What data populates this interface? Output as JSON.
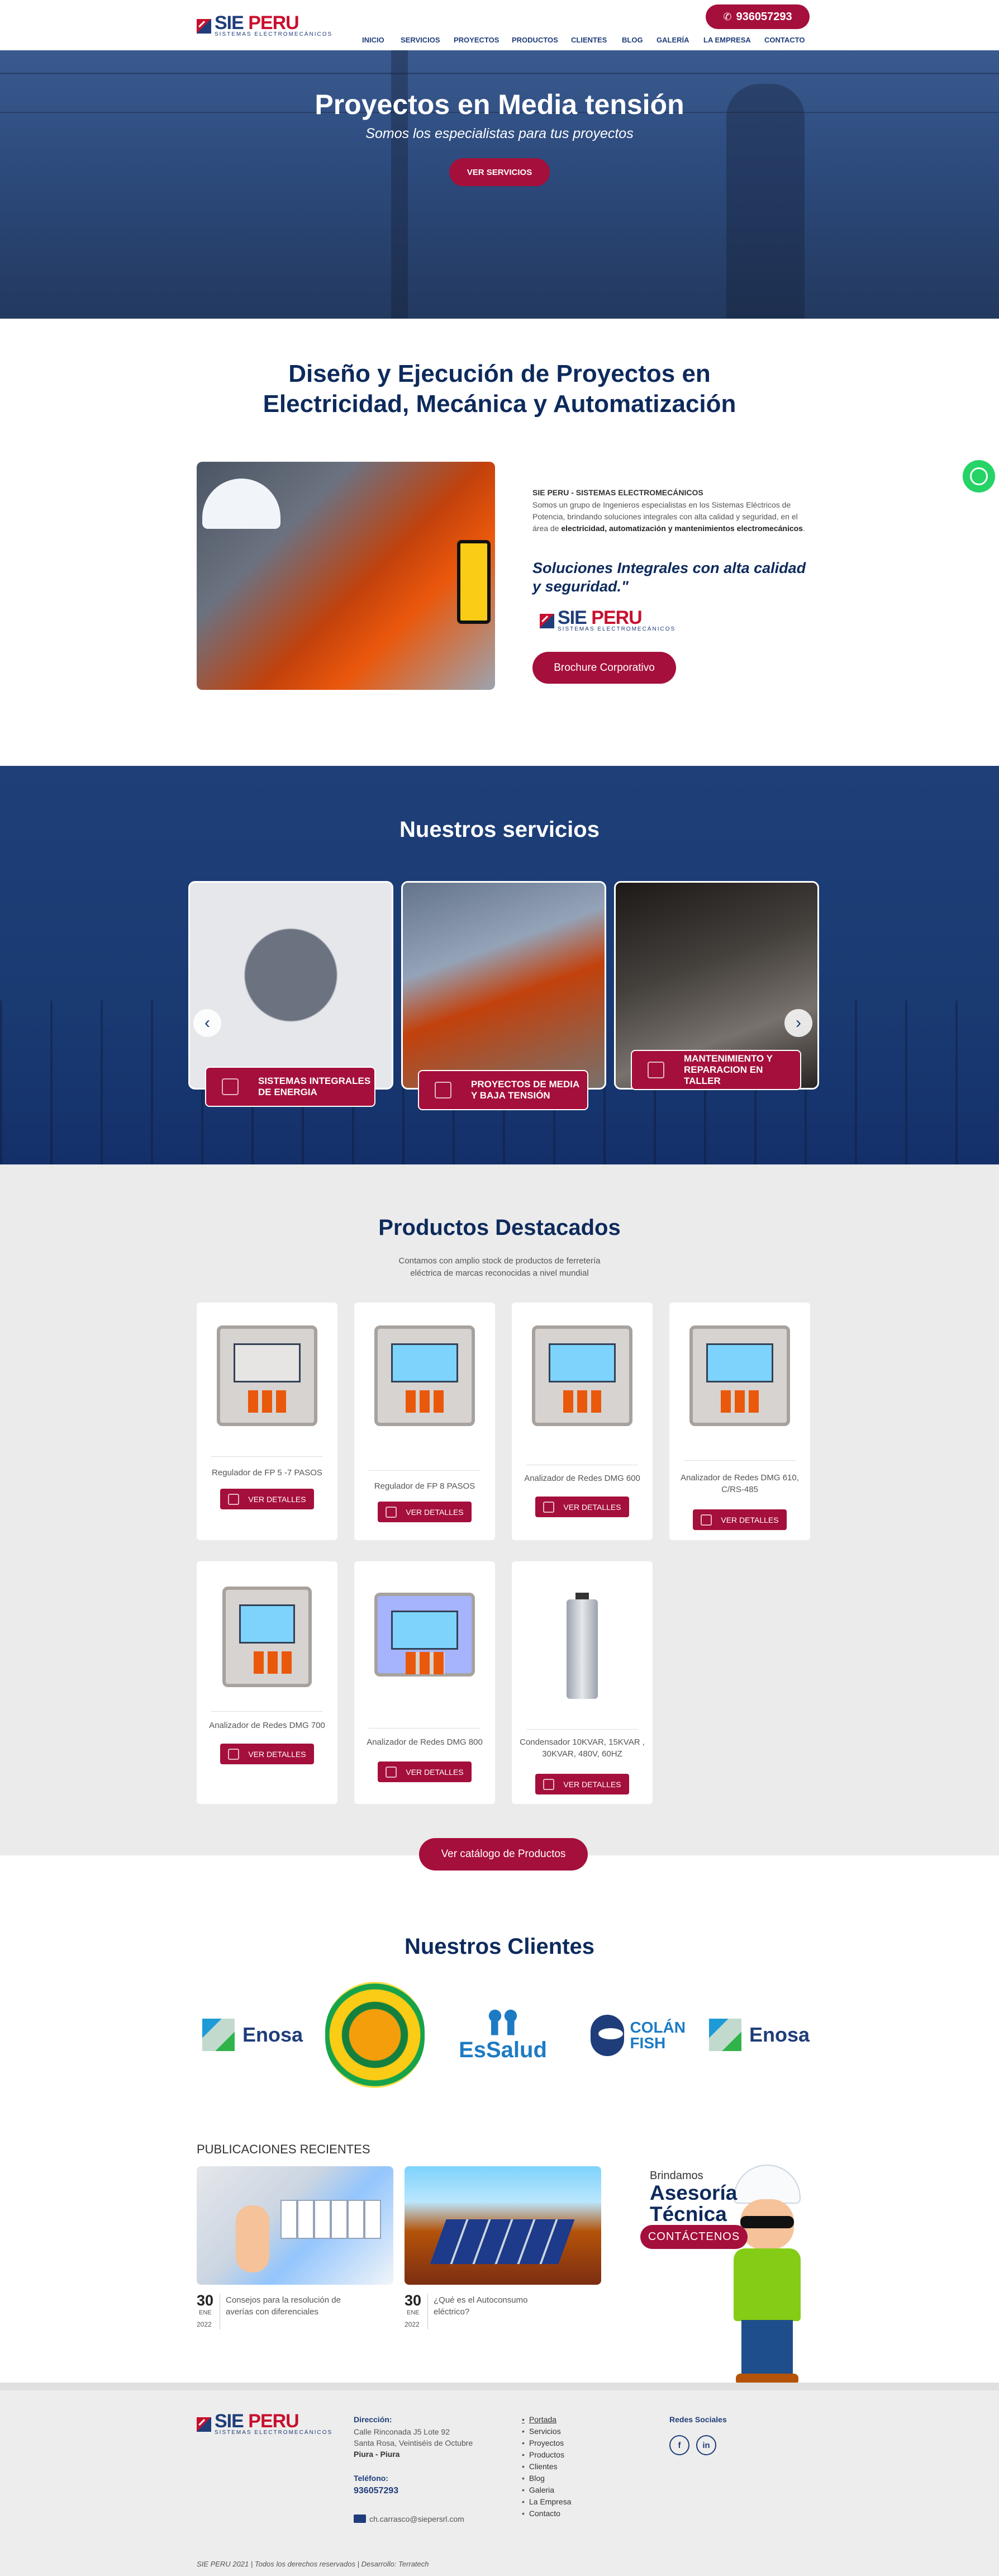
{
  "header": {
    "logo_main_1": "SIE",
    "logo_main_2": "PERU",
    "logo_sub": "SISTEMAS ELECTROMECÁNICOS",
    "phone": "936057293",
    "nav": [
      "INICIO",
      "SERVICIOS",
      "PROYECTOS",
      "PRODUCTOS",
      "CLIENTES",
      "BLOG",
      "GALERÍA",
      "LA EMPRESA",
      "CONTACTO"
    ]
  },
  "hero": {
    "title": "Proyectos en Media tensión",
    "subtitle": "Somos los especialistas para tus proyectos",
    "button": "VER SERVICIOS"
  },
  "intro": {
    "title_line1": "Diseño y Ejecución de Proyectos en",
    "title_line2": "Electricidad, Mecánica y Automatización",
    "company": "SIE PERU - SISTEMAS ELECTROMECÁNICOS",
    "desc_plain": "Somos un grupo de Ingenieros especialistas en los Sistemas Eléctricos de Potencia, brindando soluciones integrales con alta calidad y seguridad, en el área de ",
    "desc_bold": "electricidad, automatización y mantenimientos electromecánicos",
    "desc_end": ".",
    "quote": "Soluciones Integrales con alta calidad y seguridad.\"",
    "brochure": "Brochure Corporativo"
  },
  "services": {
    "title": "Nuestros servicios",
    "items": [
      {
        "label": "SISTEMAS INTEGRALES DE ENERGIA"
      },
      {
        "label": "PROYECTOS DE MEDIA Y BAJA TENSIÓN"
      },
      {
        "label": "MANTENIMIENTO Y REPARACION EN TALLER"
      }
    ],
    "prev_icon": "‹",
    "next_icon": "›"
  },
  "products": {
    "title": "Productos Destacados",
    "subtitle": "Contamos con amplio stock de productos de ferretería eléctrica de marcas reconocidas a nivel mundial",
    "button_label": "VER DETALLES",
    "items": [
      {
        "name": "Regulador de FP 5 -7 PASOS"
      },
      {
        "name": "Regulador de FP 8 PASOS"
      },
      {
        "name": "Analizador de Redes DMG 600"
      },
      {
        "name": "Analizador de Redes DMG 610, C/RS-485"
      },
      {
        "name": "Analizador de Redes DMG 700"
      },
      {
        "name": "Analizador de Redes DMG 800"
      },
      {
        "name": "Condensador 10KVAR, 15KVAR , 30KVAR, 480V, 60HZ"
      }
    ],
    "catalog_button": "Ver catálogo de Productos"
  },
  "clients": {
    "title": "Nuestros Clientes",
    "enosa": "Enosa",
    "essalud": "EsSalud",
    "colan_1": "COLÁN",
    "colan_2": "FISH"
  },
  "publications": {
    "heading": "PUBLICACIONES RECIENTES",
    "items": [
      {
        "day": "30",
        "month": "ENE",
        "year": "2022",
        "title": "Consejos para la resolución de averías con diferenciales"
      },
      {
        "day": "30",
        "month": "ENE",
        "year": "2022",
        "title": "¿Qué es el Autoconsumo eléctrico?"
      }
    ]
  },
  "advice": {
    "small": "Brindamos",
    "big_1": "Asesoría",
    "big_2": "Técnica",
    "button": "CONTÁCTENOS"
  },
  "footer": {
    "address_label": "Dirección:",
    "address_1": "Calle Rinconada J5 Lote 92",
    "address_2": "Santa Rosa, Veintiséis de Octubre",
    "address_3": "Piura - Piura",
    "phone_label": "Teléfono:",
    "phone": "936057293",
    "email": "ch.carrasco@siepersrl.com",
    "links": [
      "Portada",
      "Servicios",
      "Proyectos",
      "Productos",
      "Clientes",
      "Blog",
      "Galeria",
      "La Empresa",
      "Contacto"
    ],
    "social_label": "Redes Sociales",
    "social_fb": "f",
    "social_in": "in",
    "copyright": "SIE PERU 2021 | Todos los derechos reservados | Desarrollo: Terratech"
  },
  "colors": {
    "navy": "#0d2a5c",
    "crimson": "#a50f3b",
    "whatsapp": "#25d366"
  }
}
